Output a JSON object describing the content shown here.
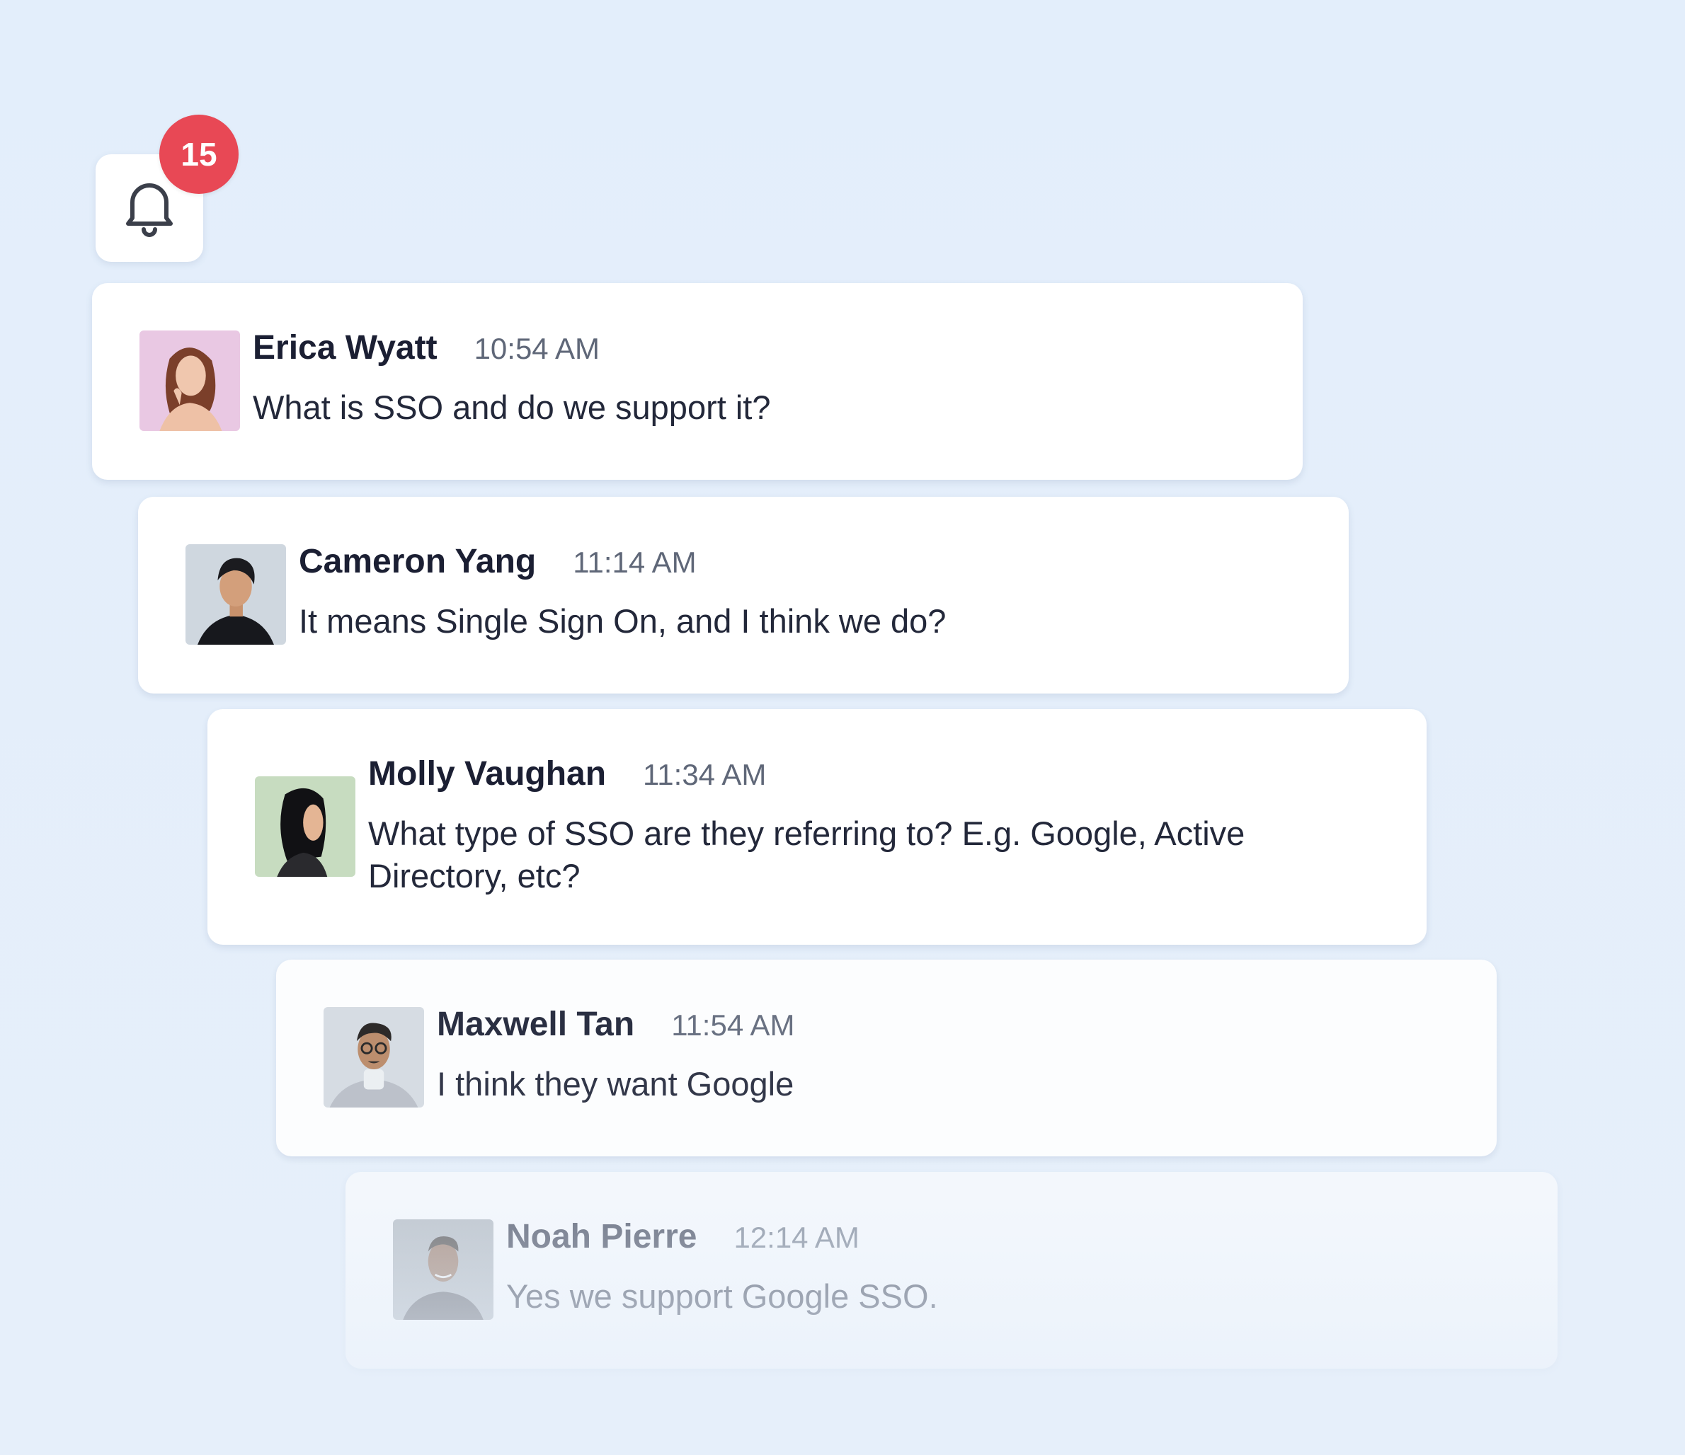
{
  "notifications": {
    "icon": "bell-icon",
    "count": "15",
    "badge_color": "#e84855"
  },
  "messages": [
    {
      "name": "Erica Wyatt",
      "time": "10:54 AM",
      "text": "What is SSO and do we support it?",
      "avatar_bg": "#e9c8e3"
    },
    {
      "name": "Cameron Yang",
      "time": "11:14 AM",
      "text": "It means Single Sign On, and I think we do?",
      "avatar_bg": "#cfd7df"
    },
    {
      "name": "Molly Vaughan",
      "time": "11:34 AM",
      "text": "What type of SSO are they referring to? E.g. Google, Active Directory, etc?",
      "avatar_bg": "#c7dcc0"
    },
    {
      "name": "Maxwell Tan",
      "time": "11:54 AM",
      "text": "I think they want Google",
      "avatar_bg": "#d5dbe2"
    },
    {
      "name": "Noah Pierre",
      "time": "12:14 AM",
      "text": "Yes we support Google SSO.",
      "avatar_bg": "#d9dde3"
    }
  ]
}
